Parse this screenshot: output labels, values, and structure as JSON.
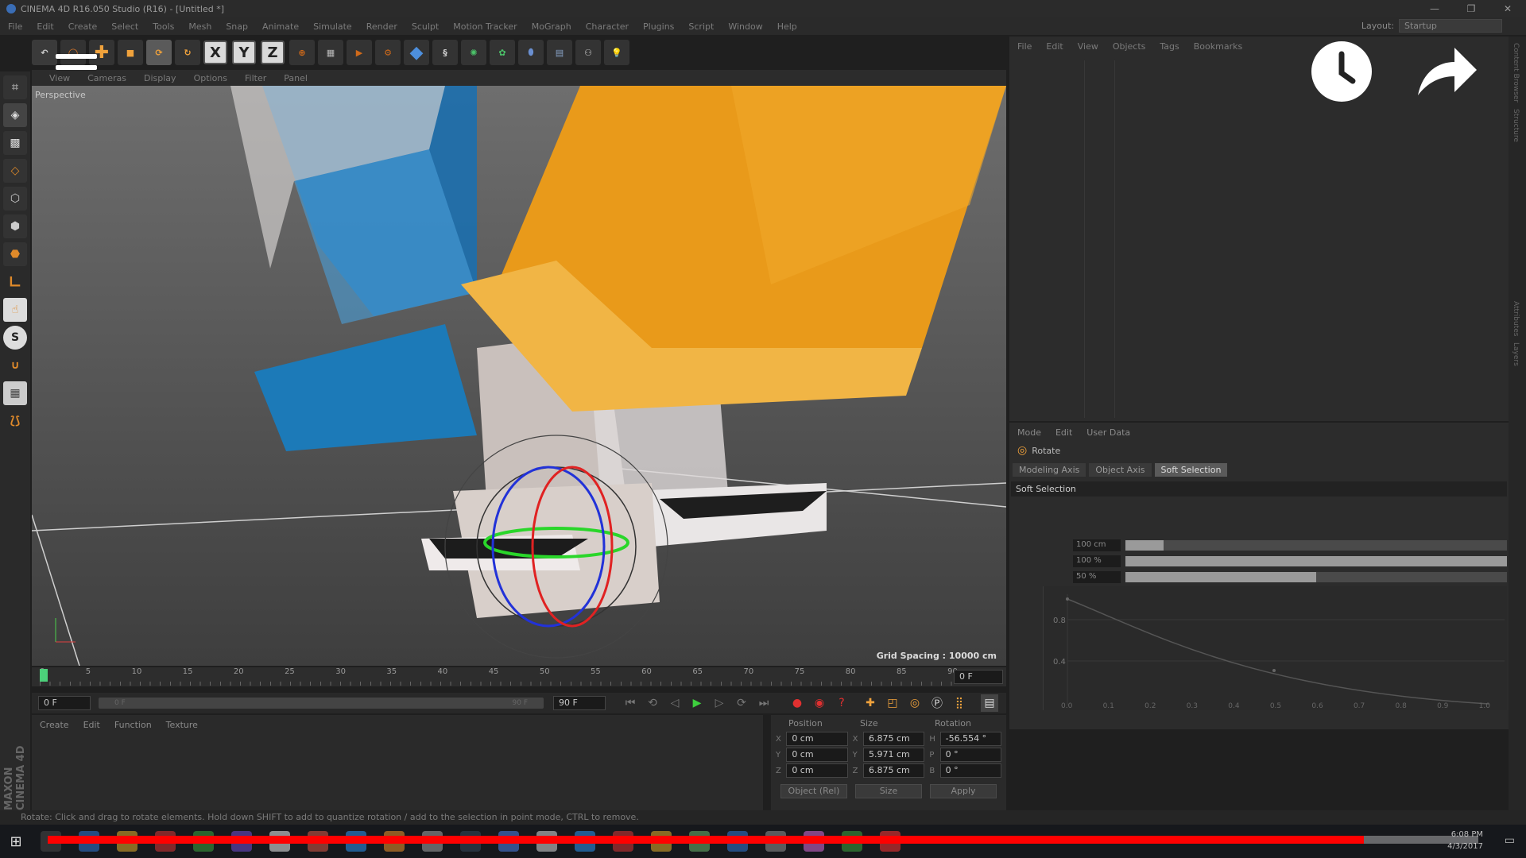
{
  "window": {
    "title": "CINEMA 4D R16.050 Studio (R16) - [Untitled *]"
  },
  "menubar": {
    "items": [
      "File",
      "Edit",
      "Create",
      "Select",
      "Tools",
      "Mesh",
      "Snap",
      "Animate",
      "Simulate",
      "Render",
      "Sculpt",
      "Motion Tracker",
      "MoGraph",
      "Character",
      "Plugins",
      "Script",
      "Window",
      "Help"
    ],
    "layout_label": "Layout:",
    "layout_value": "Startup"
  },
  "viewport": {
    "menu": [
      "View",
      "Cameras",
      "Display",
      "Options",
      "Filter",
      "Panel"
    ],
    "label": "Perspective",
    "grid_spacing": "Grid Spacing : 10000 cm"
  },
  "timeline": {
    "ticks": [
      "0",
      "5",
      "10",
      "15",
      "20",
      "25",
      "30",
      "35",
      "40",
      "45",
      "50",
      "55",
      "60",
      "65",
      "70",
      "75",
      "80",
      "85",
      "90"
    ],
    "current_frame": "0 F",
    "start_frame": "0 F",
    "range_start": "0 F",
    "range_end": "90 F",
    "end_frame": "90 F"
  },
  "material_manager": {
    "menu": [
      "Create",
      "Edit",
      "Function",
      "Texture"
    ]
  },
  "coordinates": {
    "headers": {
      "position": "Position",
      "size": "Size",
      "rotation": "Rotation"
    },
    "rows": [
      {
        "axis": "X",
        "pos": "0 cm",
        "size_axis": "X",
        "size": "6.875 cm",
        "rot_axis": "H",
        "rot": "-56.554 °"
      },
      {
        "axis": "Y",
        "pos": "0 cm",
        "size_axis": "Y",
        "size": "5.971 cm",
        "rot_axis": "P",
        "rot": "0 °"
      },
      {
        "axis": "Z",
        "pos": "0 cm",
        "size_axis": "Z",
        "size": "6.875 cm",
        "rot_axis": "B",
        "rot": "0 °"
      }
    ],
    "mode": "Object (Rel)",
    "size_mode": "Size",
    "apply": "Apply"
  },
  "status": {
    "text": "Rotate: Click and drag to rotate elements. Hold down SHIFT to add to quantize rotation / add to the selection in point mode, CTRL to remove."
  },
  "object_manager": {
    "menu": [
      "File",
      "Edit",
      "View",
      "Objects",
      "Tags",
      "Bookmarks"
    ]
  },
  "attributes": {
    "menu": [
      "Mode",
      "Edit",
      "User Data"
    ],
    "tool_name": "Rotate",
    "tabs": [
      "Modeling Axis",
      "Object Axis",
      "Soft Selection"
    ],
    "section": "Soft Selection",
    "params": [
      {
        "value": "100 cm",
        "fill": 0.1
      },
      {
        "value": "100 %",
        "fill": 1.0
      },
      {
        "value": "50 %",
        "fill": 0.5
      }
    ],
    "curve_y": [
      "0.8",
      "0.4"
    ],
    "curve_x": [
      "0.0",
      "0.1",
      "0.2",
      "0.3",
      "0.4",
      "0.5",
      "0.6",
      "0.7",
      "0.8",
      "0.9",
      "1.0"
    ]
  },
  "right_strip": [
    "Content Browser",
    "Structure",
    "Attributes",
    "Layers"
  ],
  "side_brand": "MAXON CINEMA 4D",
  "clock": {
    "time": "6:08 PM",
    "date": "4/3/2017"
  },
  "video": {
    "progress": 0.92
  }
}
